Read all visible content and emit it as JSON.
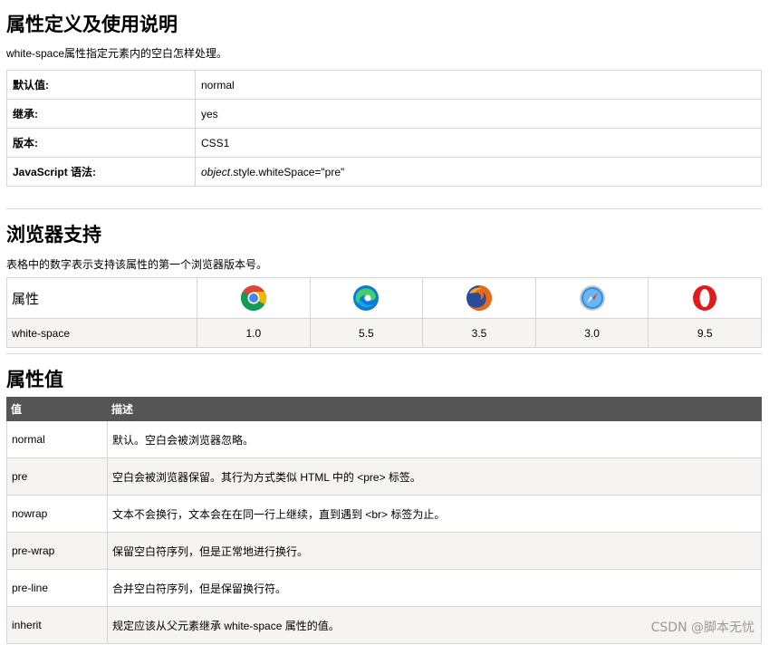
{
  "definition": {
    "title": "属性定义及使用说明",
    "description": "white-space属性指定元素内的空白怎样处理。",
    "rows": [
      {
        "key": "默认值:",
        "value": "normal"
      },
      {
        "key": "继承:",
        "value": "yes"
      },
      {
        "key": "版本:",
        "value": "CSS1"
      },
      {
        "key": "JavaScript 语法:",
        "value_italic": "object",
        "value_rest": ".style.whiteSpace=\"pre\""
      }
    ]
  },
  "browser_support": {
    "title": "浏览器支持",
    "description": "表格中的数字表示支持该属性的第一个浏览器版本号。",
    "header_label": "属性",
    "browsers": [
      "chrome-icon",
      "edge-icon",
      "firefox-icon",
      "safari-icon",
      "opera-icon"
    ],
    "property": "white-space",
    "versions": [
      "1.0",
      "5.5",
      "3.5",
      "3.0",
      "9.5"
    ]
  },
  "values": {
    "title": "属性值",
    "columns": [
      "值",
      "描述"
    ],
    "rows": [
      {
        "value": "normal",
        "desc": "默认。空白会被浏览器忽略。"
      },
      {
        "value": "pre",
        "desc": "空白会被浏览器保留。其行为方式类似 HTML 中的 <pre> 标签。"
      },
      {
        "value": "nowrap",
        "desc": "文本不会换行，文本会在在同一行上继续，直到遇到 <br> 标签为止。"
      },
      {
        "value": "pre-wrap",
        "desc": "保留空白符序列，但是正常地进行换行。"
      },
      {
        "value": "pre-line",
        "desc": "合并空白符序列，但是保留换行符。"
      },
      {
        "value": "inherit",
        "desc": "规定应该从父元素继承 white-space 属性的值。"
      }
    ]
  },
  "watermark": "CSDN @脚本无忧"
}
